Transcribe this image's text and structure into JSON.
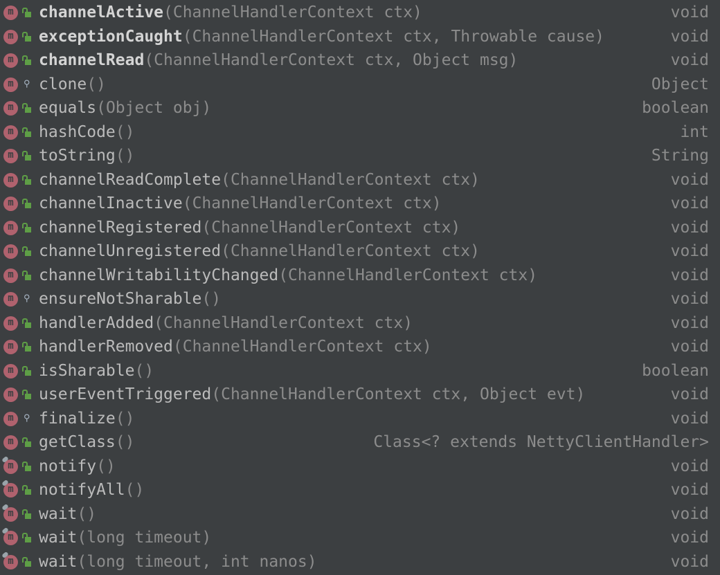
{
  "colors": {
    "background": "#3c3f41",
    "method_icon": "#b0626e",
    "public_lock": "#5e9e46",
    "name_text": "#bbbbbb",
    "param_text": "#8c8c8c"
  },
  "items": [
    {
      "name": "channelActive",
      "params": "(ChannelHandlerContext ctx)",
      "type": "void",
      "bold": true,
      "visibility": "public",
      "final": false
    },
    {
      "name": "exceptionCaught",
      "params": "(ChannelHandlerContext ctx, Throwable cause)",
      "type": "void",
      "bold": true,
      "visibility": "public",
      "final": false
    },
    {
      "name": "channelRead",
      "params": "(ChannelHandlerContext ctx, Object msg)",
      "type": "void",
      "bold": true,
      "visibility": "public",
      "final": false
    },
    {
      "name": "clone",
      "params": "()",
      "type": "Object",
      "bold": false,
      "visibility": "protected",
      "final": false
    },
    {
      "name": "equals",
      "params": "(Object obj)",
      "type": "boolean",
      "bold": false,
      "visibility": "public",
      "final": false
    },
    {
      "name": "hashCode",
      "params": "()",
      "type": "int",
      "bold": false,
      "visibility": "public",
      "final": false
    },
    {
      "name": "toString",
      "params": "()",
      "type": "String",
      "bold": false,
      "visibility": "public",
      "final": false
    },
    {
      "name": "channelReadComplete",
      "params": "(ChannelHandlerContext ctx)",
      "type": "void",
      "bold": false,
      "visibility": "public",
      "final": false
    },
    {
      "name": "channelInactive",
      "params": "(ChannelHandlerContext ctx)",
      "type": "void",
      "bold": false,
      "visibility": "public",
      "final": false
    },
    {
      "name": "channelRegistered",
      "params": "(ChannelHandlerContext ctx)",
      "type": "void",
      "bold": false,
      "visibility": "public",
      "final": false
    },
    {
      "name": "channelUnregistered",
      "params": "(ChannelHandlerContext ctx)",
      "type": "void",
      "bold": false,
      "visibility": "public",
      "final": false
    },
    {
      "name": "channelWritabilityChanged",
      "params": "(ChannelHandlerContext ctx)",
      "type": "void",
      "bold": false,
      "visibility": "public",
      "final": false
    },
    {
      "name": "ensureNotSharable",
      "params": "()",
      "type": "void",
      "bold": false,
      "visibility": "protected",
      "final": false
    },
    {
      "name": "handlerAdded",
      "params": "(ChannelHandlerContext ctx)",
      "type": "void",
      "bold": false,
      "visibility": "public",
      "final": false
    },
    {
      "name": "handlerRemoved",
      "params": "(ChannelHandlerContext ctx)",
      "type": "void",
      "bold": false,
      "visibility": "public",
      "final": false
    },
    {
      "name": "isSharable",
      "params": "()",
      "type": "boolean",
      "bold": false,
      "visibility": "public",
      "final": false
    },
    {
      "name": "userEventTriggered",
      "params": "(ChannelHandlerContext ctx, Object evt)",
      "type": "void",
      "bold": false,
      "visibility": "public",
      "final": false
    },
    {
      "name": "finalize",
      "params": "()",
      "type": "void",
      "bold": false,
      "visibility": "protected",
      "final": false
    },
    {
      "name": "getClass",
      "params": "()",
      "type": "Class<? extends NettyClientHandler>",
      "bold": false,
      "visibility": "public",
      "final": false
    },
    {
      "name": "notify",
      "params": "()",
      "type": "void",
      "bold": false,
      "visibility": "public",
      "final": true
    },
    {
      "name": "notifyAll",
      "params": "()",
      "type": "void",
      "bold": false,
      "visibility": "public",
      "final": true
    },
    {
      "name": "wait",
      "params": "()",
      "type": "void",
      "bold": false,
      "visibility": "public",
      "final": true
    },
    {
      "name": "wait",
      "params": "(long timeout)",
      "type": "void",
      "bold": false,
      "visibility": "public",
      "final": true
    },
    {
      "name": "wait",
      "params": "(long timeout, int nanos)",
      "type": "void",
      "bold": false,
      "visibility": "public",
      "final": true
    }
  ]
}
